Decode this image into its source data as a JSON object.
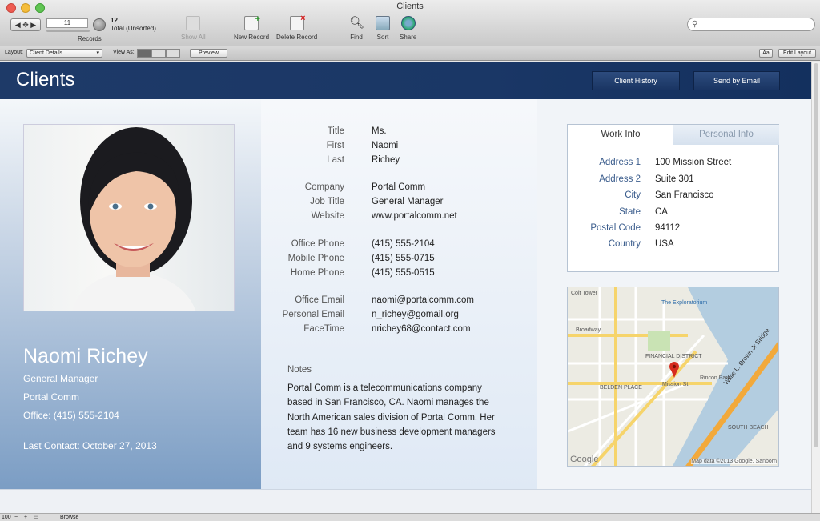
{
  "window": {
    "title": "Clients"
  },
  "toolbar": {
    "record_number": "11",
    "records_label": "Records",
    "total_count": "12",
    "total_label": "Total (Unsorted)",
    "show_all": "Show All",
    "new_record": "New Record",
    "delete_record": "Delete Record",
    "find": "Find",
    "sort": "Sort",
    "share": "Share"
  },
  "layout_bar": {
    "layout_label": "Layout:",
    "layout_value": "Client Details",
    "view_as_label": "View As:",
    "preview": "Preview",
    "edit_layout": "Edit Layout",
    "aa": "Aa"
  },
  "header": {
    "title": "Clients",
    "client_history": "Client History",
    "send_by_email": "Send by Email"
  },
  "profile": {
    "name": "Naomi Richey",
    "job": "General Manager",
    "company": "Portal Comm",
    "office": "Office: (415) 555-2104",
    "last_contact": "Last Contact: October 27, 2013"
  },
  "fields": [
    {
      "label": "Title",
      "value": "Ms."
    },
    {
      "label": "First",
      "value": "Naomi"
    },
    {
      "label": "Last",
      "value": "Richey"
    },
    {
      "label": "Company",
      "value": "Portal Comm"
    },
    {
      "label": "Job Title",
      "value": "General Manager"
    },
    {
      "label": "Website",
      "value": "www.portalcomm.net"
    },
    {
      "label": "Office Phone",
      "value": "(415) 555-2104"
    },
    {
      "label": "Mobile Phone",
      "value": "(415) 555-0715"
    },
    {
      "label": "Home Phone",
      "value": "(415) 555-0515"
    },
    {
      "label": "Office Email",
      "value": "naomi@portalcomm.com"
    },
    {
      "label": "Personal Email",
      "value": "n_richey@gomail.org"
    },
    {
      "label": "FaceTime",
      "value": "nrichey68@contact.com"
    }
  ],
  "notes": {
    "label": "Notes",
    "text": "Portal Comm is a telecommunications company based in San Francisco, CA. Naomi manages the North American sales division of Portal Comm. Her team has 16 new business development managers and 9 systems engineers."
  },
  "tabs": {
    "work": "Work Info",
    "personal": "Personal Info"
  },
  "address": [
    {
      "label": "Address 1",
      "value": "100 Mission Street"
    },
    {
      "label": "Address 2",
      "value": "Suite 301"
    },
    {
      "label": "City",
      "value": "San Francisco"
    },
    {
      "label": "State",
      "value": "CA"
    },
    {
      "label": "Postal Code",
      "value": "94112"
    },
    {
      "label": "Country",
      "value": "USA"
    }
  ],
  "map": {
    "labels": [
      "Coit Tower",
      "The Exploratorium",
      "Broadway",
      "FINANCIAL DISTRICT",
      "Rincon Park",
      "BELDEN PLACE",
      "SOUTH BEACH",
      "Willie L. Brown Jr Bridge",
      "Mission St",
      "Map data ©2013 Google, Sanborn",
      "Google"
    ]
  },
  "status": {
    "zoom": "100",
    "mode": "Browse"
  },
  "colors": {
    "header": "#1a3766",
    "accent": "#3a5c8c"
  }
}
